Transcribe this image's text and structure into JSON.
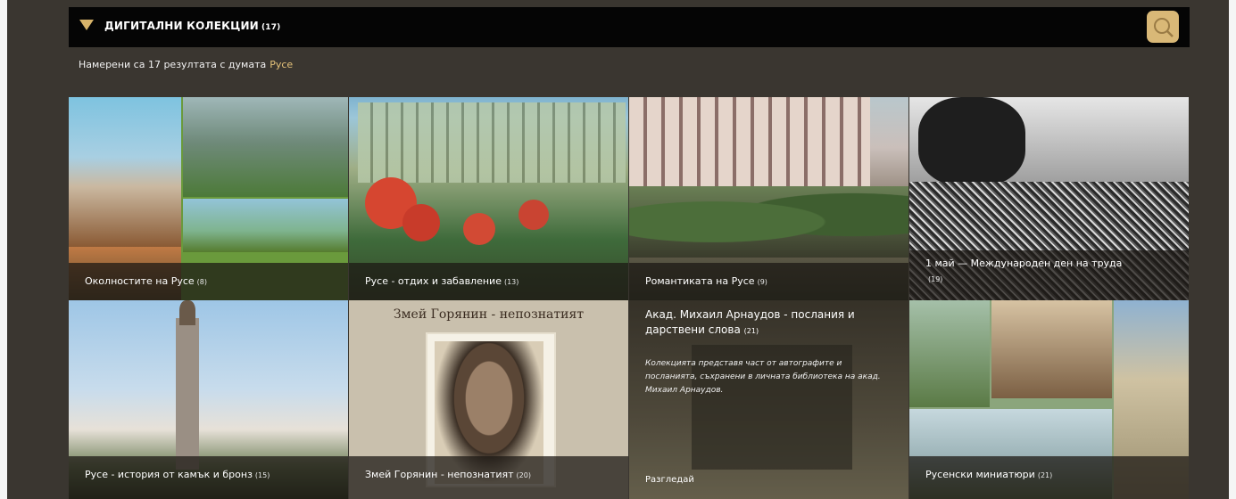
{
  "header": {
    "title": "ДИГИТАЛНИ КОЛЕКЦИИ",
    "count": "(17)",
    "search_icon": "magnifier-icon",
    "accent_color": "#d9b877"
  },
  "results": {
    "prefix": "Намерени са 17 резултата с думата",
    "keyword": "Русе"
  },
  "collections": [
    {
      "title": "Околностите на Русе",
      "count": "(8)"
    },
    {
      "title": "Русе - отдих и забавление",
      "count": "(13)"
    },
    {
      "title": "Романтиката на Русе",
      "count": "(9)"
    },
    {
      "title": "1 май — Международен ден на труда",
      "count": "(19)"
    },
    {
      "title": "Русе - история от камък и бронз",
      "count": "(15)"
    },
    {
      "title": "Змей Горянин - непознатият",
      "count": "(20)",
      "image_caption": "Змей Горянин - непознатият"
    },
    {
      "title": "Акад. Михаил Арнаудов - послания и дарствени слова",
      "count": "(21)",
      "description": "Колекцията представя част от автографите и посланията, съхранени в личната библиотека на акад. Михаил Арнаудов.",
      "link_label": "Разгледай"
    },
    {
      "title": "Русенски миниатюри",
      "count": "(21)"
    }
  ]
}
